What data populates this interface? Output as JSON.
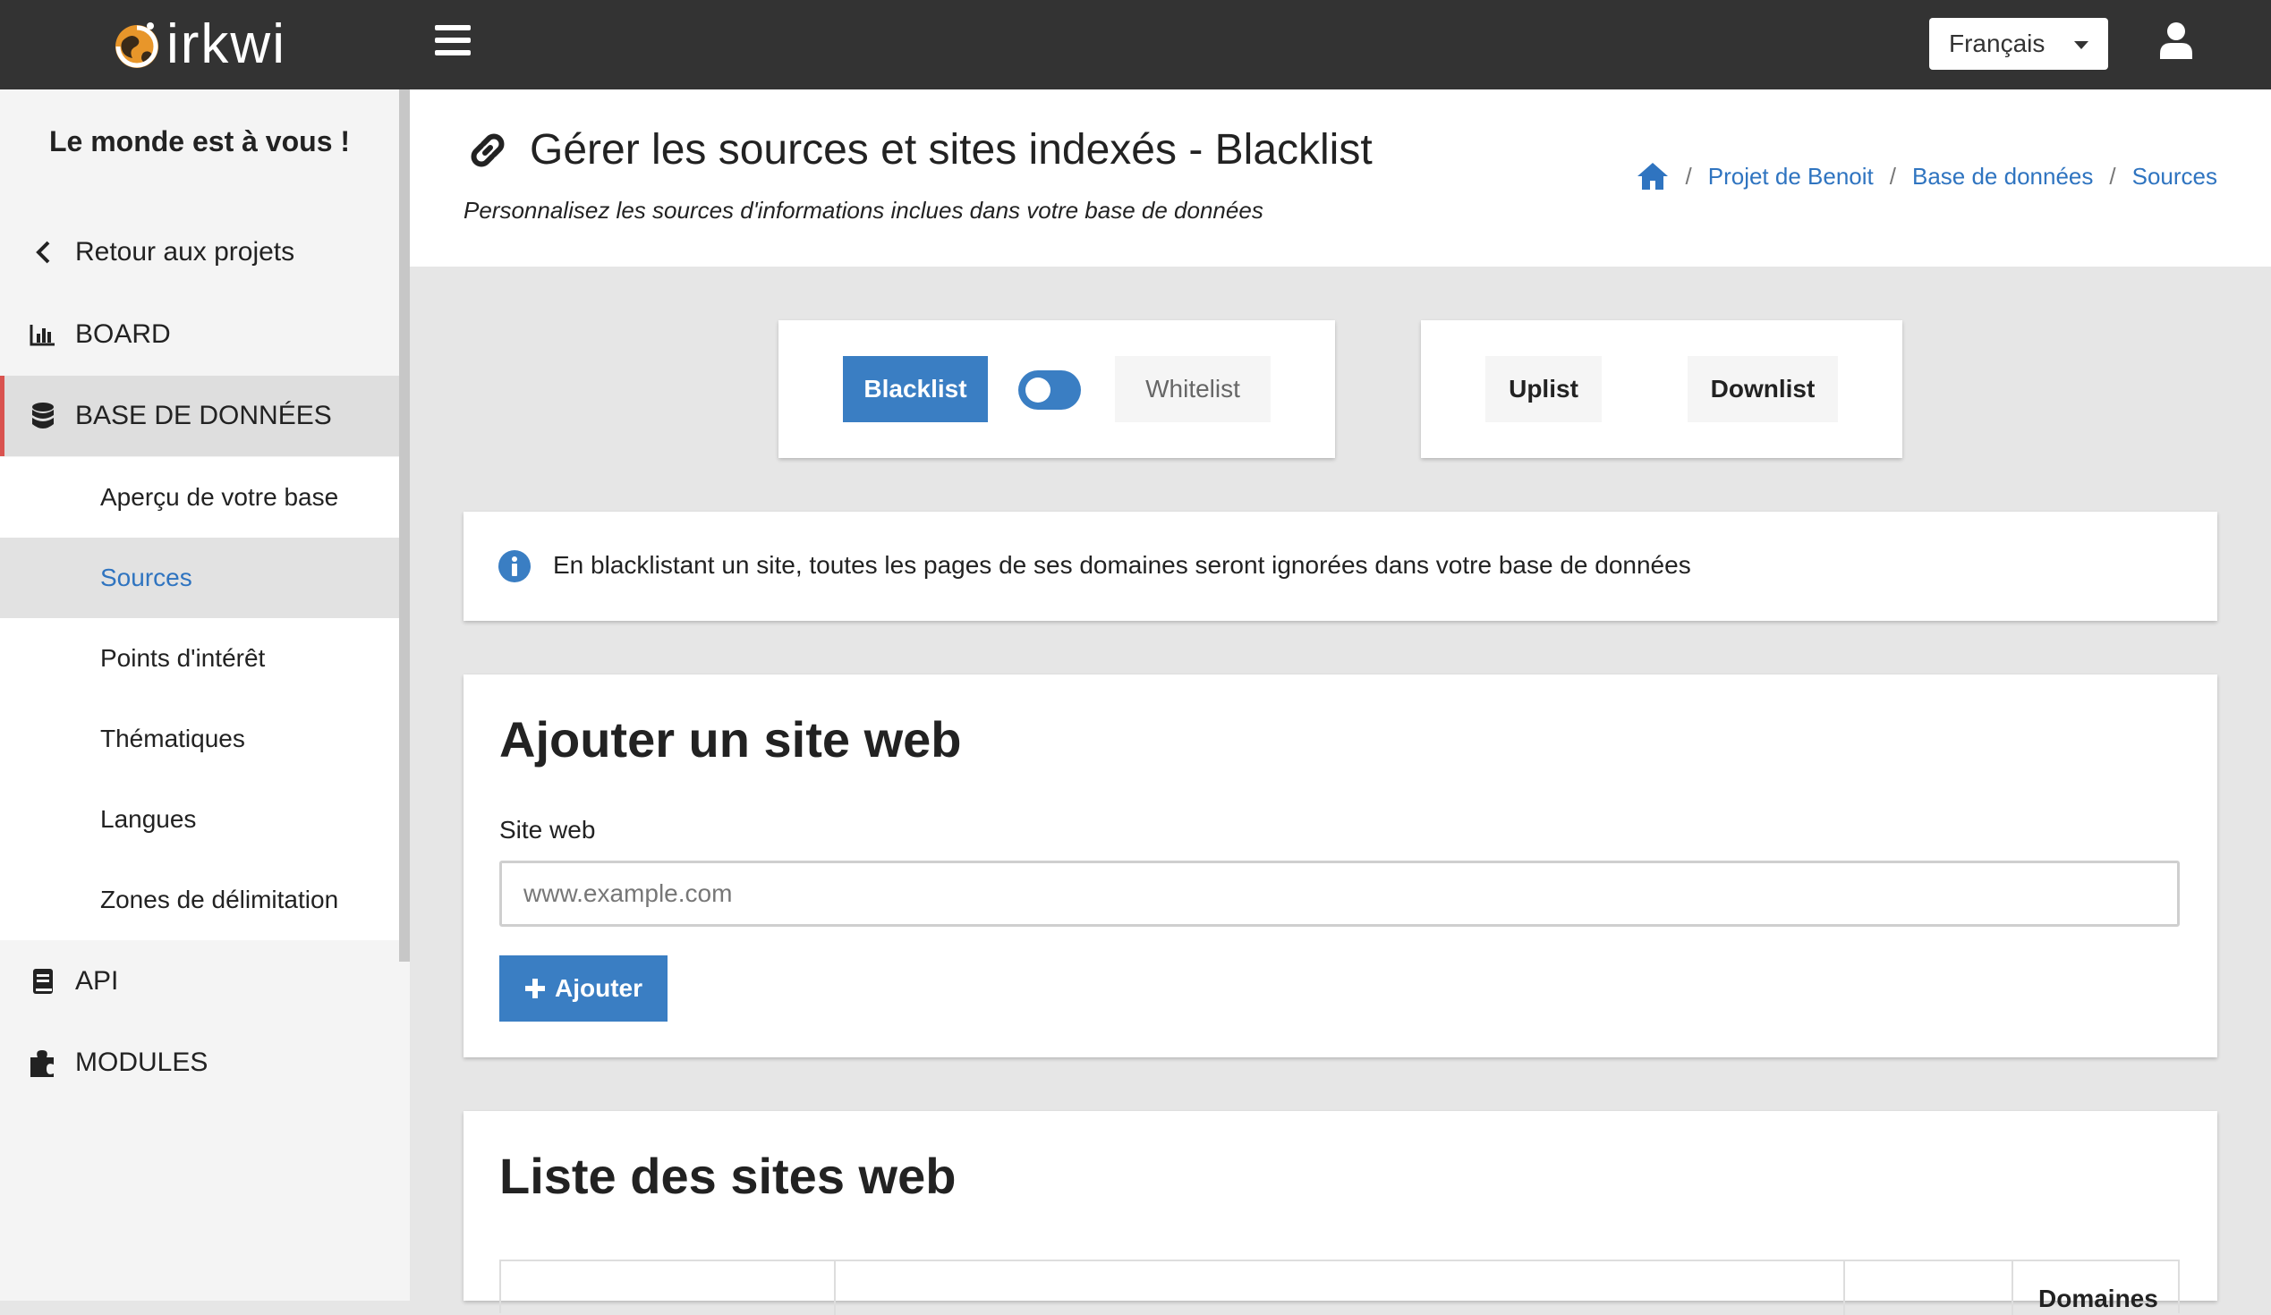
{
  "header": {
    "logo_text": "irkwi",
    "language": "Français"
  },
  "sidebar": {
    "tagline": "Le monde est à vous !",
    "back": "Retour aux projets",
    "board": "BOARD",
    "database": "BASE DE DONNÉES",
    "sub_items": [
      "Aperçu de votre base",
      "Sources",
      "Points d'intérêt",
      "Thématiques",
      "Langues",
      "Zones de délimitation"
    ],
    "api": "API",
    "modules": "MODULES"
  },
  "page": {
    "title": "Gérer les sources et sites indexés - Blacklist",
    "subtitle": "Personnalisez les sources d'informations inclues dans votre base de données",
    "breadcrumb": [
      "Projet de Benoit",
      "Base de données",
      "Sources"
    ]
  },
  "list_mode": {
    "blacklist": "Blacklist",
    "whitelist": "Whitelist",
    "uplist": "Uplist",
    "downlist": "Downlist"
  },
  "info": {
    "message": "En blacklistant un site, toutes les pages de ses domaines seront ignorées dans votre base de données"
  },
  "add_site": {
    "title": "Ajouter un site web",
    "label": "Site web",
    "placeholder": "www.example.com",
    "button": "Ajouter"
  },
  "site_list": {
    "title": "Liste des sites web",
    "column_domaines": "Domaines"
  },
  "colors": {
    "primary": "#3a7ec3",
    "link": "#2f74c0",
    "topbar": "#333333",
    "active_marker": "#d9534f"
  }
}
